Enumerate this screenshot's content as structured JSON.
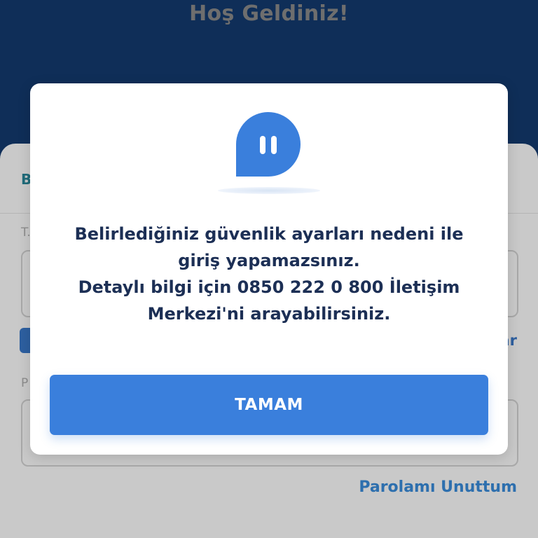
{
  "header": {
    "title": "Hoş Geldiniz!"
  },
  "background_form": {
    "tab_fragment": "B",
    "field1_label_fragment": "T.",
    "remember_fragment": "ar",
    "field2_label_fragment": "P",
    "forgot_password_link": "Parolamı Unuttum"
  },
  "modal": {
    "icon": "chat-bubble-pause-icon",
    "message": "Belirlediğiniz güvenlik ayarları nedeni ile\ngiriş yapamazsınız.\nDetaylı bilgi için 0850 222 0 800 İletişim\nMerkezi'ni arayabilirsiniz.",
    "ok_button_label": "TAMAM"
  },
  "colors": {
    "header_bg": "#0f2e58",
    "accent": "#3a7fdc",
    "message_text": "#1c2f55",
    "link": "#2d6fae"
  }
}
